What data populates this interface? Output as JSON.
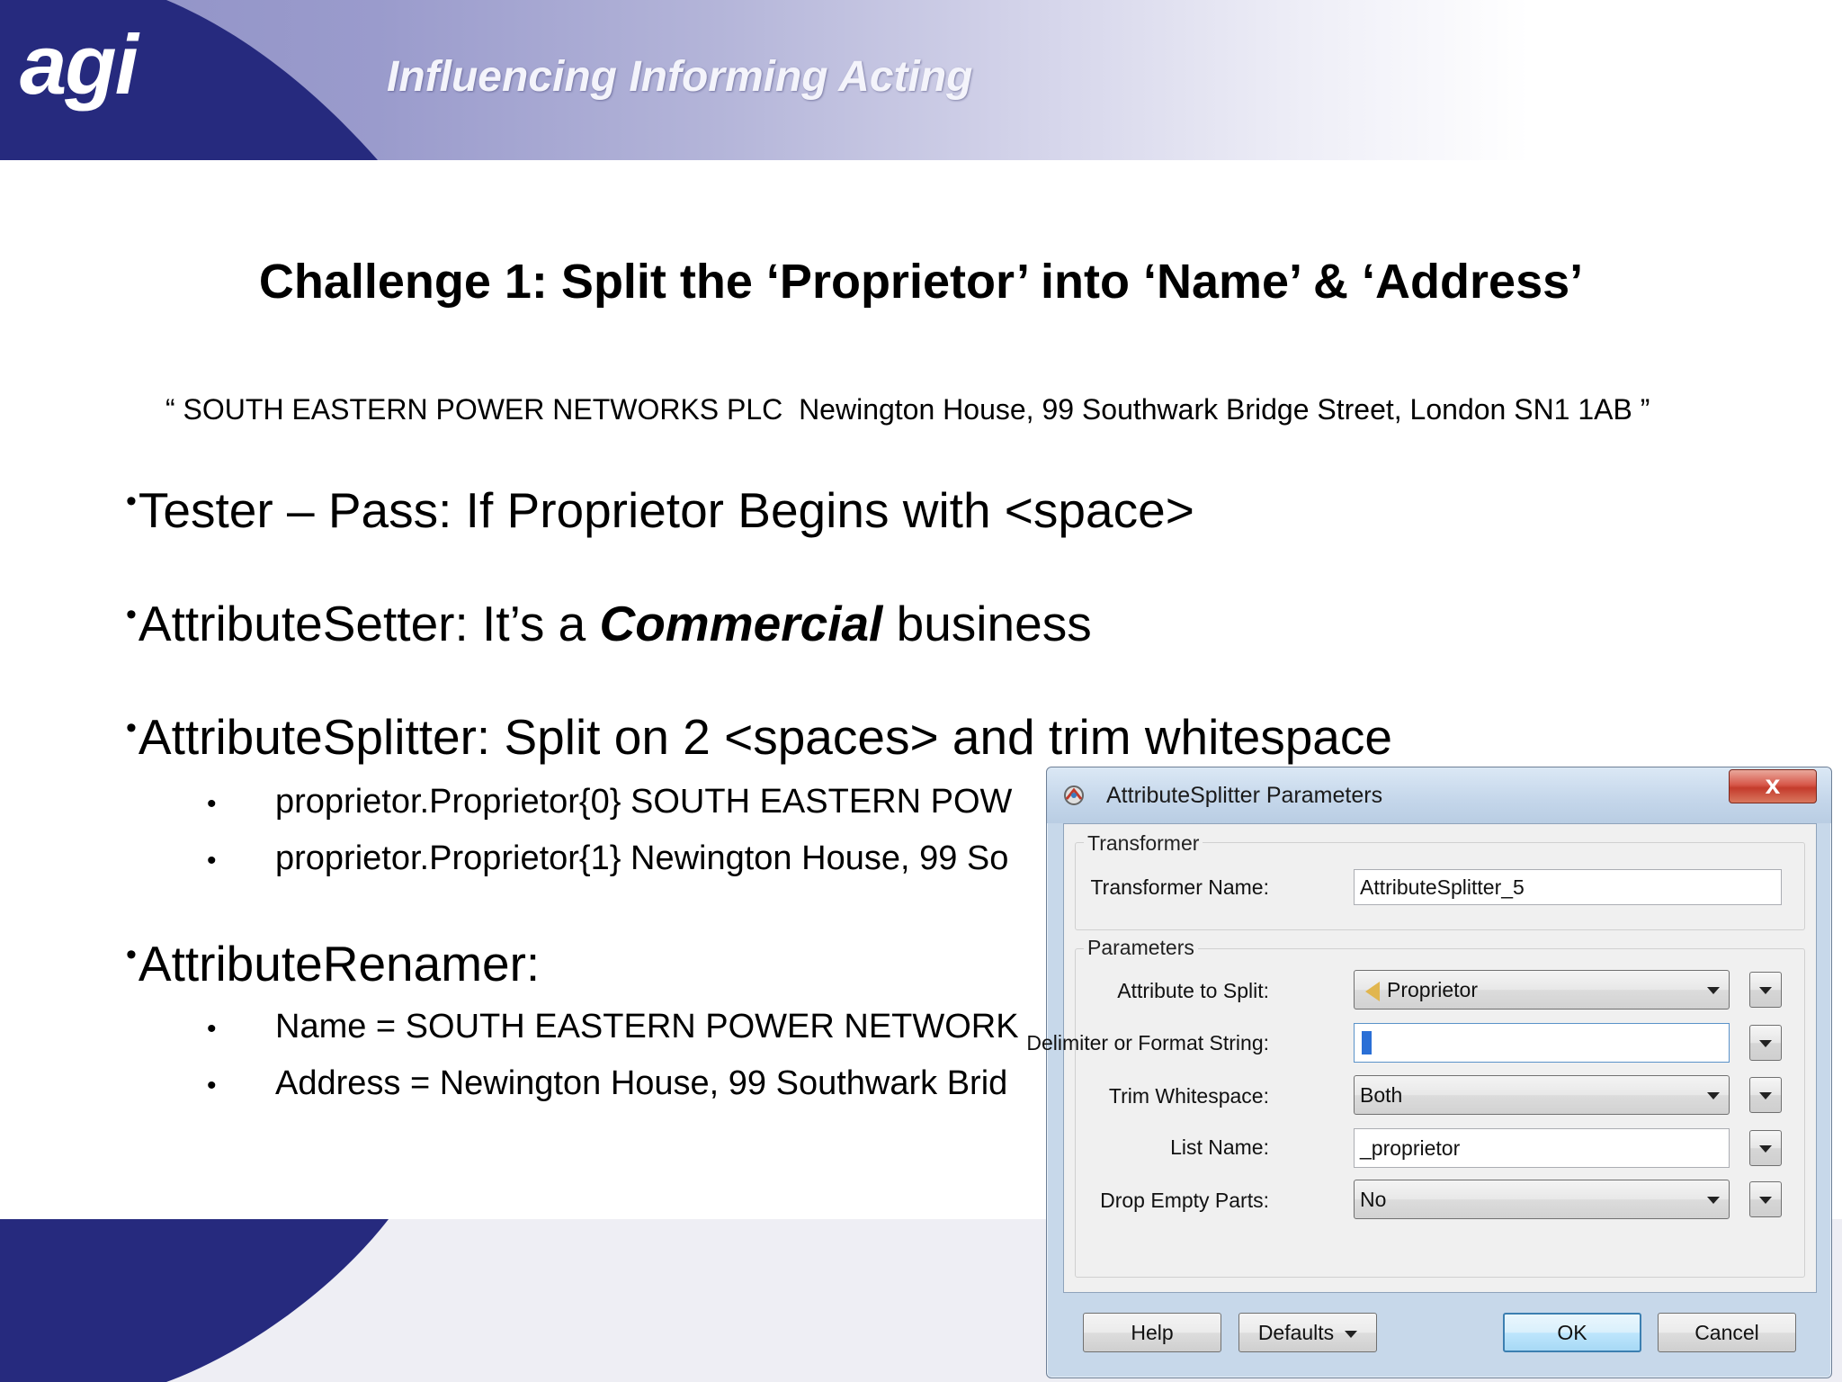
{
  "header": {
    "logo": "agi",
    "tagline": "Influencing Informing Acting"
  },
  "slide": {
    "title": "Challenge 1: Split the ‘Proprietor’ into ‘Name’ & ‘Address’",
    "quote": "“ SOUTH EASTERN POWER NETWORKS PLC  Newington House, 99 Southwark Bridge Street, London SN1 1AB ”",
    "bullet_glyph": "•",
    "sub_bullet_glyph": "•",
    "bullets": [
      {
        "text": "Tester – Pass: If Proprietor Begins with <space>"
      },
      {
        "prefix": "AttributeSetter: It’s a ",
        "emphasis": "Commercial",
        "suffix": " business"
      },
      {
        "text": "AttributeSplitter: Split on 2 <spaces> and trim whitespace",
        "subs": [
          "proprietor.Proprietor{0} SOUTH EASTERN POW",
          "proprietor.Proprietor{1} Newington House, 99 So"
        ]
      },
      {
        "text": "AttributeRenamer:",
        "subs": [
          "Name = SOUTH EASTERN POWER NETWORK",
          "Address = Newington House, 99 Southwark Brid"
        ]
      }
    ]
  },
  "dialog": {
    "title": "AttributeSplitter Parameters",
    "close_glyph": "x",
    "transformer_group": "Transformer",
    "transformer_name_label": "Transformer Name:",
    "transformer_name_value": "AttributeSplitter_5",
    "parameters_group": "Parameters",
    "attribute_to_split_label": "Attribute to Split:",
    "attribute_to_split_value": "Proprietor",
    "attribute_icon": "attribute-icon",
    "delimiter_label": "Delimiter or Format String:",
    "delimiter_value": "",
    "trim_label": "Trim Whitespace:",
    "trim_value": "Both",
    "list_name_label": "List Name:",
    "list_name_value": "_proprietor",
    "drop_empty_label": "Drop Empty Parts:",
    "drop_empty_value": "No",
    "help_button": "Help",
    "defaults_button": "Defaults",
    "ok_button": "OK",
    "cancel_button": "Cancel"
  },
  "colors": {
    "brand_navy": "#262a7e",
    "header_light": "#9a9bcc",
    "ok_accent": "#3c7fb1",
    "close_red": "#c43b2c"
  }
}
